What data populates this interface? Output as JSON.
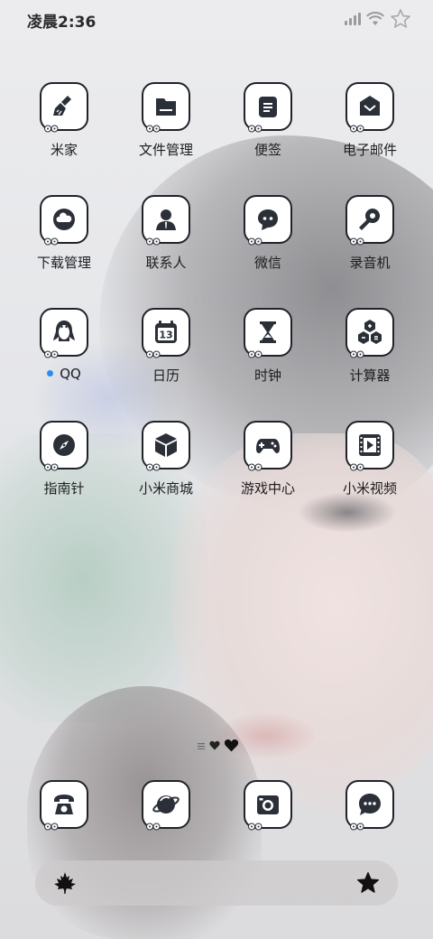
{
  "status_bar": {
    "time": "凌晨2:36",
    "icons": [
      "signal-icon",
      "wifi-icon",
      "star-icon"
    ]
  },
  "apps": [
    {
      "label": "米家",
      "icon": "broom-icon"
    },
    {
      "label": "文件管理",
      "icon": "folder-icon"
    },
    {
      "label": "便签",
      "icon": "notes-icon"
    },
    {
      "label": "电子邮件",
      "icon": "mail-icon"
    },
    {
      "label": "下载管理",
      "icon": "cloud-download-icon"
    },
    {
      "label": "联系人",
      "icon": "person-icon"
    },
    {
      "label": "微信",
      "icon": "chat-bubble-icon"
    },
    {
      "label": "录音机",
      "icon": "microphone-icon"
    },
    {
      "label": "QQ",
      "icon": "penguin-icon",
      "new_dot": true
    },
    {
      "label": "日历",
      "icon": "calendar-icon",
      "day": "13"
    },
    {
      "label": "时钟",
      "icon": "hourglass-icon"
    },
    {
      "label": "计算器",
      "icon": "calculator-icon"
    },
    {
      "label": "指南针",
      "icon": "compass-icon"
    },
    {
      "label": "小米商城",
      "icon": "box-icon"
    },
    {
      "label": "游戏中心",
      "icon": "gamepad-icon"
    },
    {
      "label": "小米视频",
      "icon": "play-film-icon"
    }
  ],
  "page_indicator": {
    "icons": [
      "menu-lines-icon",
      "heart-icon",
      "heart-icon"
    ]
  },
  "dock": [
    {
      "icon": "telephone-icon"
    },
    {
      "icon": "planet-icon"
    },
    {
      "icon": "camera-icon"
    },
    {
      "icon": "message-icon"
    }
  ],
  "dock_bar": {
    "left_icon": "maple-leaf-icon",
    "right_icon": "star-icon"
  },
  "colors": {
    "icon_dark": "#2b3038",
    "tile_border": "#1f2328",
    "tile_bg": "#ffffff",
    "new_dot": "#2a8cf0"
  }
}
